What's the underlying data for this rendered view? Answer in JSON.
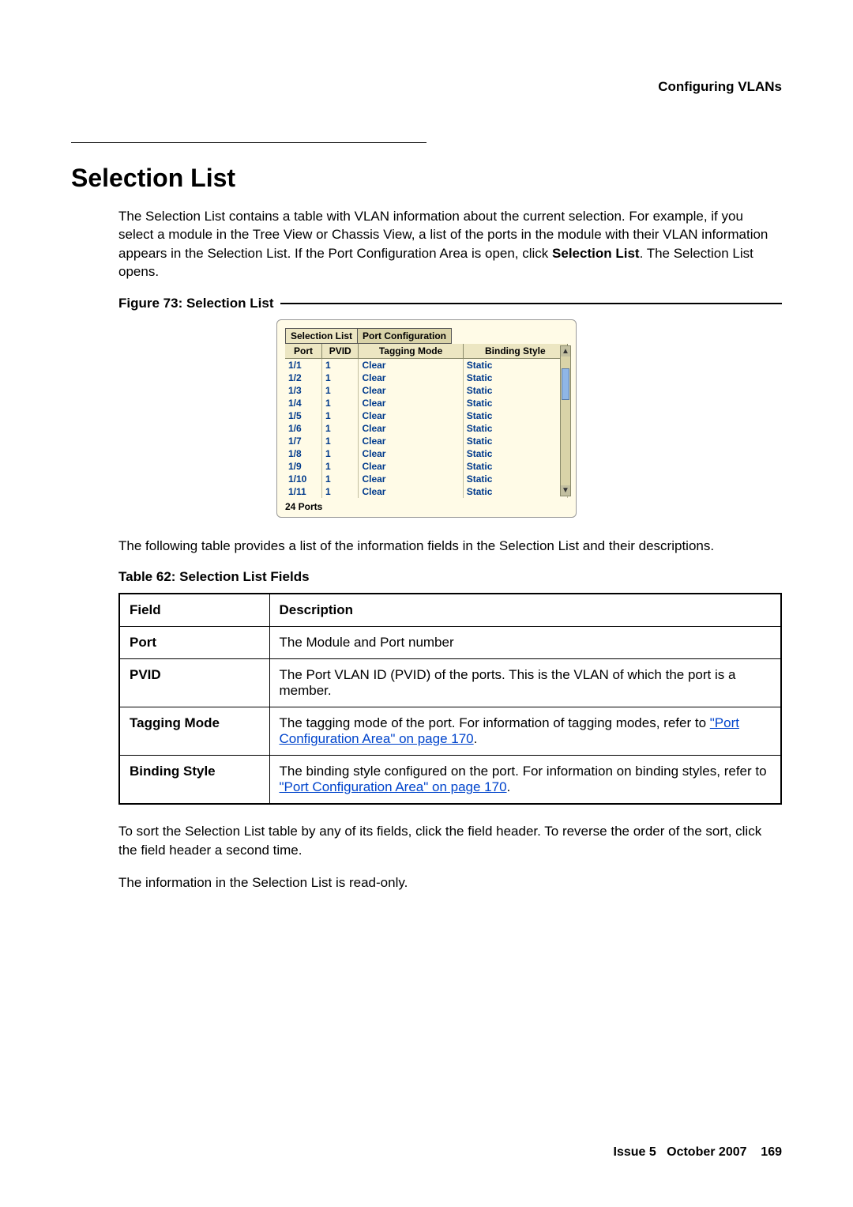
{
  "header": {
    "breadcrumb": "Configuring VLANs"
  },
  "section": {
    "title": "Selection List",
    "intro_before_bold": "The Selection List contains a table with VLAN information about the current selection. For example, if you select a module in the Tree View or Chassis View, a list of the ports in the module with their VLAN information appears in the Selection List. If the Port Configuration Area is open, click ",
    "intro_bold": "Selection List",
    "intro_after_bold": ". The Selection List opens."
  },
  "figure": {
    "caption": "Figure 73: Selection List",
    "tabs": {
      "active": "Selection List",
      "inactive": "Port Configuration"
    },
    "headers": {
      "port": "Port",
      "pvid": "PVID",
      "tagging": "Tagging Mode",
      "binding": "Binding Style"
    },
    "rows": [
      {
        "port": "1/1",
        "pvid": "1",
        "tagging": "Clear",
        "binding": "Static"
      },
      {
        "port": "1/2",
        "pvid": "1",
        "tagging": "Clear",
        "binding": "Static"
      },
      {
        "port": "1/3",
        "pvid": "1",
        "tagging": "Clear",
        "binding": "Static"
      },
      {
        "port": "1/4",
        "pvid": "1",
        "tagging": "Clear",
        "binding": "Static"
      },
      {
        "port": "1/5",
        "pvid": "1",
        "tagging": "Clear",
        "binding": "Static"
      },
      {
        "port": "1/6",
        "pvid": "1",
        "tagging": "Clear",
        "binding": "Static"
      },
      {
        "port": "1/7",
        "pvid": "1",
        "tagging": "Clear",
        "binding": "Static"
      },
      {
        "port": "1/8",
        "pvid": "1",
        "tagging": "Clear",
        "binding": "Static"
      },
      {
        "port": "1/9",
        "pvid": "1",
        "tagging": "Clear",
        "binding": "Static"
      },
      {
        "port": "1/10",
        "pvid": "1",
        "tagging": "Clear",
        "binding": "Static"
      },
      {
        "port": "1/11",
        "pvid": "1",
        "tagging": "Clear",
        "binding": "Static"
      }
    ],
    "footer": "24 Ports"
  },
  "after_figure_text": "The following table provides a list of the information fields in the Selection List and their descriptions.",
  "table": {
    "caption": "Table 62: Selection List Fields",
    "headers": {
      "field": "Field",
      "desc": "Description"
    },
    "rows": [
      {
        "field": "Port",
        "desc_pre": "The Module and Port number",
        "link": "",
        "desc_post": ""
      },
      {
        "field": "PVID",
        "desc_pre": "The Port VLAN ID (PVID) of the ports. This is the VLAN of which the port is a member.",
        "link": "",
        "desc_post": ""
      },
      {
        "field": "Tagging Mode",
        "desc_pre": "The tagging mode of the port. For information of tagging modes, refer to ",
        "link": "\"Port Configuration Area\" on page 170",
        "desc_post": "."
      },
      {
        "field": "Binding Style",
        "desc_pre": "The binding style configured on the port. For information on binding styles, refer to ",
        "link": "\"Port Configuration Area\" on page 170",
        "desc_post": "."
      }
    ]
  },
  "closing": {
    "p1": "To sort the Selection List table by any of its fields, click the field header. To reverse the order of the sort, click the field header a second time.",
    "p2": "The information in the Selection List is read-only."
  },
  "footer": {
    "issue_label": "Issue 5",
    "date": "October 2007",
    "page": "169"
  }
}
